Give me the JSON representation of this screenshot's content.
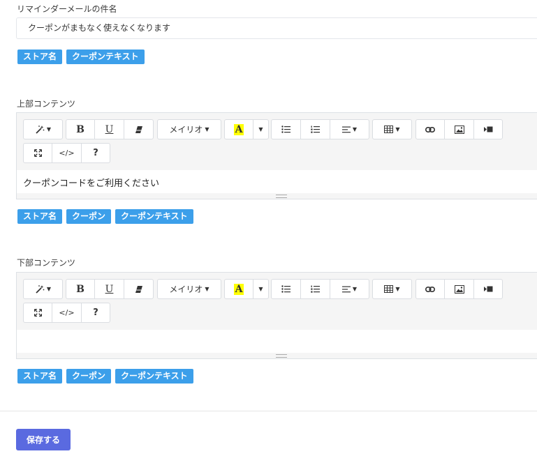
{
  "subject": {
    "label": "リマインダーメールの件名",
    "value": "クーポンがまもなく使えなくなります",
    "tags": [
      "ストア名",
      "クーポンテキスト"
    ]
  },
  "top_content": {
    "label": "上部コンテンツ",
    "body": "クーポンコードをご利用ください",
    "tags": [
      "ストア名",
      "クーポン",
      "クーポンテキスト"
    ]
  },
  "bottom_content": {
    "label": "下部コンテンツ",
    "body": "",
    "tags": [
      "ストア名",
      "クーポン",
      "クーポンテキスト"
    ]
  },
  "toolbar": {
    "bold": "B",
    "underline": "U",
    "font_name": "メイリオ",
    "font_color_letter": "A",
    "code": "</>",
    "help": "?"
  },
  "actions": {
    "save_label": "保存する"
  },
  "colors": {
    "tag": "#3c9fea",
    "save_button": "#5a6ae0",
    "highlight": "#ffff00"
  }
}
